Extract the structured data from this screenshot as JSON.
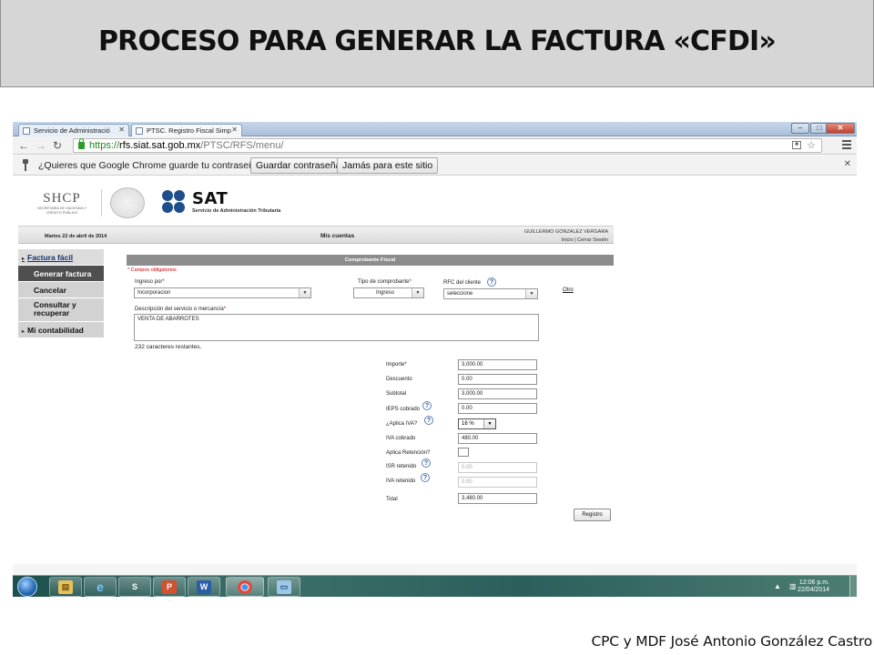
{
  "slide": {
    "title": "PROCESO PARA GENERAR LA FACTURA «CFDI»",
    "footer": "CPC y MDF José Antonio González Castro"
  },
  "browser": {
    "tabs": [
      {
        "label": "Servicio de Administració"
      },
      {
        "label": "PTSC. Registro Fiscal Simp"
      }
    ],
    "url_scheme": "https://",
    "url_host": "rfs.siat.sat.gob.mx",
    "url_path": "/PTSC/RFS/menu/",
    "infobar": {
      "question": "¿Quieres que Google Chrome guarde tu contraseña?",
      "save_label": "Guardar contraseña",
      "never_label": "Jamás para este sitio"
    }
  },
  "header": {
    "shcp_logo": "SHCP",
    "shcp_sub": "SECRETARÍA DE HACIENDA Y CRÉDITO PÚBLICO",
    "sat_logo": "SAT",
    "sat_sub": "Servicio de Administración Tributaria",
    "date": "Martes 22 de abril de 2014",
    "section": "Mis cuentas",
    "user": "GUILLERMO GONZALEZ VERGARA",
    "links": "Inicio | Cerrar Sesión"
  },
  "sidebar": {
    "items": [
      {
        "label": "Factura fácil"
      },
      {
        "label": "Generar factura"
      },
      {
        "label": "Cancelar"
      },
      {
        "label": "Consultar y recuperar"
      },
      {
        "label": "Mi contabilidad"
      }
    ]
  },
  "form": {
    "title": "Comprobante Fiscal",
    "required_note": "* Campos obligatorios",
    "ingreso_label": "Ingreso por",
    "ingreso_value": "Incorporacion",
    "tipo_label": "Tipo de comprobante",
    "tipo_value": "Ingreso",
    "rfc_label": "RFC del cliente",
    "rfc_value": "seleccione",
    "otro_link": "Otro",
    "desc_label": "Descripción del servicio o mercancía",
    "desc_value": "VENTA DE ABARROTES",
    "remaining": "232 caracteres restantes.",
    "importe_label": "Importe",
    "importe": "3,000.00",
    "descuento_label": "Descuento",
    "descuento": "0.00",
    "subtotal_label": "Subtotal",
    "subtotal": "3,000.00",
    "ieps_label": "IEPS cobrado",
    "ieps": "0.00",
    "aplica_iva_label": "¿Aplica IVA?",
    "iva_rate": "16 %",
    "iva_cobrado_label": "IVA cobrado",
    "iva_cobrado": "480.00",
    "aplica_ret_label": "Aplica Retención?",
    "isr_label": "ISR retenido",
    "isr": "0.00",
    "iva_ret_label": "IVA retenido",
    "iva_ret": "0.00",
    "total_label": "Total",
    "total": "3,480.00",
    "submit": "Registro"
  },
  "taskbar": {
    "time": "12:06 p.m.",
    "date": "22/04/2014"
  }
}
